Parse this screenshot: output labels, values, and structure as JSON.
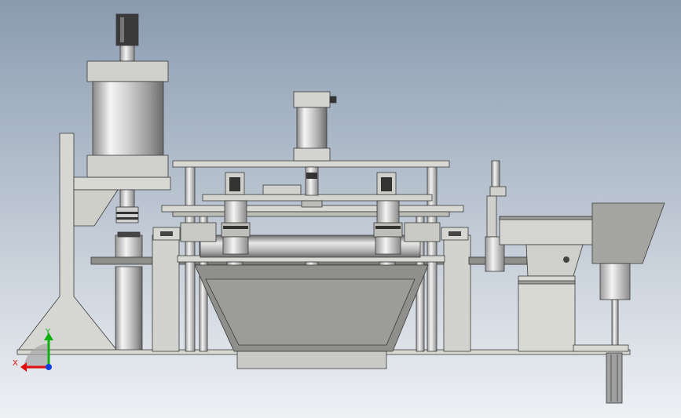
{
  "viewport": {
    "background_top": "#8a9bb0",
    "background_bottom": "#eef1f4"
  },
  "colors": {
    "steel_light": "#f2f2f2",
    "steel_mid": "#b9b9b9",
    "steel_dark": "#6f6f6f",
    "plate": "#d9d9d4",
    "plate_dark": "#9e9e9a",
    "bowl": "#8d8d8a",
    "black_part": "#2c2c2c",
    "axis_x": "#e01010",
    "axis_y": "#10b010",
    "axis_z": "#1040e0"
  },
  "triad": {
    "x_label": "X",
    "y_label": "Y",
    "icon": "coordinate-triad-icon"
  }
}
